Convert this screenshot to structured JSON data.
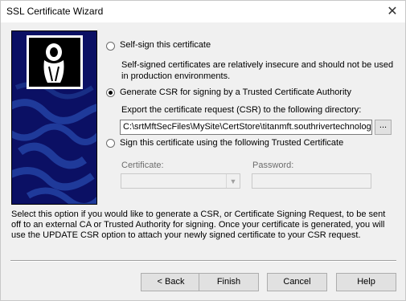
{
  "window": {
    "title": "SSL Certificate Wizard",
    "close_glyph": "✕"
  },
  "options": {
    "self_sign": {
      "label": "Self-sign this certificate",
      "description": "Self-signed certificates are relatively insecure and should not be used in production environments.",
      "checked": false
    },
    "generate_csr": {
      "label": "Generate CSR for signing by a Trusted Certificate Authority",
      "export_label": "Export the certificate request (CSR) to the following directory:",
      "directory_value": "C:\\srtMftSecFiles\\MySite\\CertStore\\titanmft.southrivertechnologie",
      "browse_label": "...",
      "checked": true
    },
    "sign_trusted": {
      "label": "Sign this certificate using  the following Trusted Certificate",
      "certificate_label": "Certificate:",
      "certificate_value": "",
      "password_label": "Password:",
      "password_value": "",
      "checked": false
    }
  },
  "help_text": "Select this option if you would like to generate a CSR, or Certificate Signing Request, to be sent off to an external CA or Trusted Authority for signing. Once your certificate is generated, you will use the UPDATE CSR option to attach your newly signed certificate to your CSR request.",
  "buttons": {
    "back": "< Back",
    "finish": "Finish",
    "cancel": "Cancel",
    "help": "Help"
  },
  "icons": {
    "close": "close-icon",
    "wizard_image": "certificate-wizard-figure-icon",
    "combo_arrow": "chevron-down-icon"
  },
  "colors": {
    "wizard_image_background": "#0b1064",
    "wizard_image_pattern": "#1f3a9a"
  }
}
